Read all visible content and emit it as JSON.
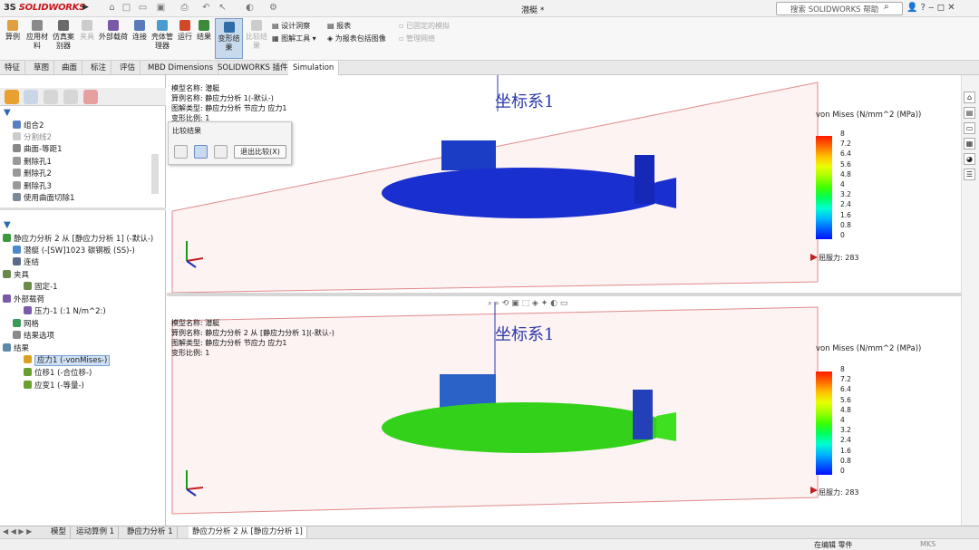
{
  "app": {
    "logo_brand": "3S",
    "logo_text": "SOLIDWORKS",
    "doc_title": "潜艇 *"
  },
  "search": {
    "placeholder": "搜索 SOLIDWORKS 帮助"
  },
  "ribbon": {
    "study": "算例",
    "apply_material": "应用材料",
    "mesh_solver": "仿真案别器",
    "fixtures": "夹具",
    "external_loads": "外部载荷",
    "connections": "连接",
    "shell_manager": "壳体管理器",
    "run": "运行",
    "results": "结果",
    "deformed_result": "变形结果",
    "compare_results": "比较结果",
    "design_study": "设计洞察",
    "plot_tools": "图解工具",
    "report": "报表",
    "include_image": "为报表包括图像",
    "deactivated_options": "已固定的模拟",
    "manage_network": "管理网络"
  },
  "tabs": [
    "特征",
    "草图",
    "曲面",
    "标注",
    "评估",
    "MBD Dimensions",
    "SOLIDWORKS 插件",
    "Simulation"
  ],
  "tree_top": [
    "组合2",
    "分割线2",
    "曲面-等距1",
    "删除孔1",
    "删除孔2",
    "删除孔3",
    "使用曲面切除1"
  ],
  "study_tree": {
    "root": "静应力分析 2 从 [静应力分析 1] (-默认-)",
    "body": "潜艇 (-[SW]1023 碳钢板 (SS)-)",
    "connections": "连结",
    "fixtures": "夹具",
    "fixed": "固定-1",
    "loads": "外部载荷",
    "pressure": "压力-1 (:1 N/m^2:)",
    "mesh": "网格",
    "result_options": "结果选项",
    "results": "结果",
    "stress": "应力1 (-vonMises-)",
    "displacement": "位移1 (-合位移-)",
    "strain": "应变1 (-等量-)"
  },
  "top_view": {
    "model_name": "模型名称: 潜艇",
    "study_name": "算例名称: 静应力分析 1(-默认-)",
    "plot_type": "图解类型: 静应力分析 节应力 应力1",
    "scale": "变形比例: 1",
    "coord": "坐标系1"
  },
  "bottom_view": {
    "model_name": "模型名称: 潜艇",
    "study_name": "算例名称: 静应力分析 2 从 [静应力分析 1](-默认-)",
    "plot_type": "图解类型: 静应力分析 节应力 应力1",
    "scale": "变形比例: 1",
    "coord": "坐标系1"
  },
  "compare": {
    "title": "比较结果",
    "exit_label": "退出比较(X)"
  },
  "legend": {
    "title": "von Mises (N/mm^2 (MPa))",
    "ticks": [
      "8",
      "7.2",
      "6.4",
      "5.6",
      "4.8",
      "4",
      "3.2",
      "2.4",
      "1.6",
      "0.8",
      "0"
    ],
    "yield_label": "屈服力: 283",
    "colors": [
      "#ff1a00",
      "#ff6a00",
      "#ffc000",
      "#e8ff00",
      "#9dff00",
      "#3dff00",
      "#00ff5a",
      "#00ffd0",
      "#00b8ff",
      "#0060ff",
      "#0010ff"
    ]
  },
  "bottom_tabs": [
    "模型",
    "运动算例 1",
    "静应力分析 1",
    "静应力分析 2 从 [静应力分析 1]"
  ],
  "status": {
    "text": "在编辑 零件",
    "units": "MKS"
  }
}
